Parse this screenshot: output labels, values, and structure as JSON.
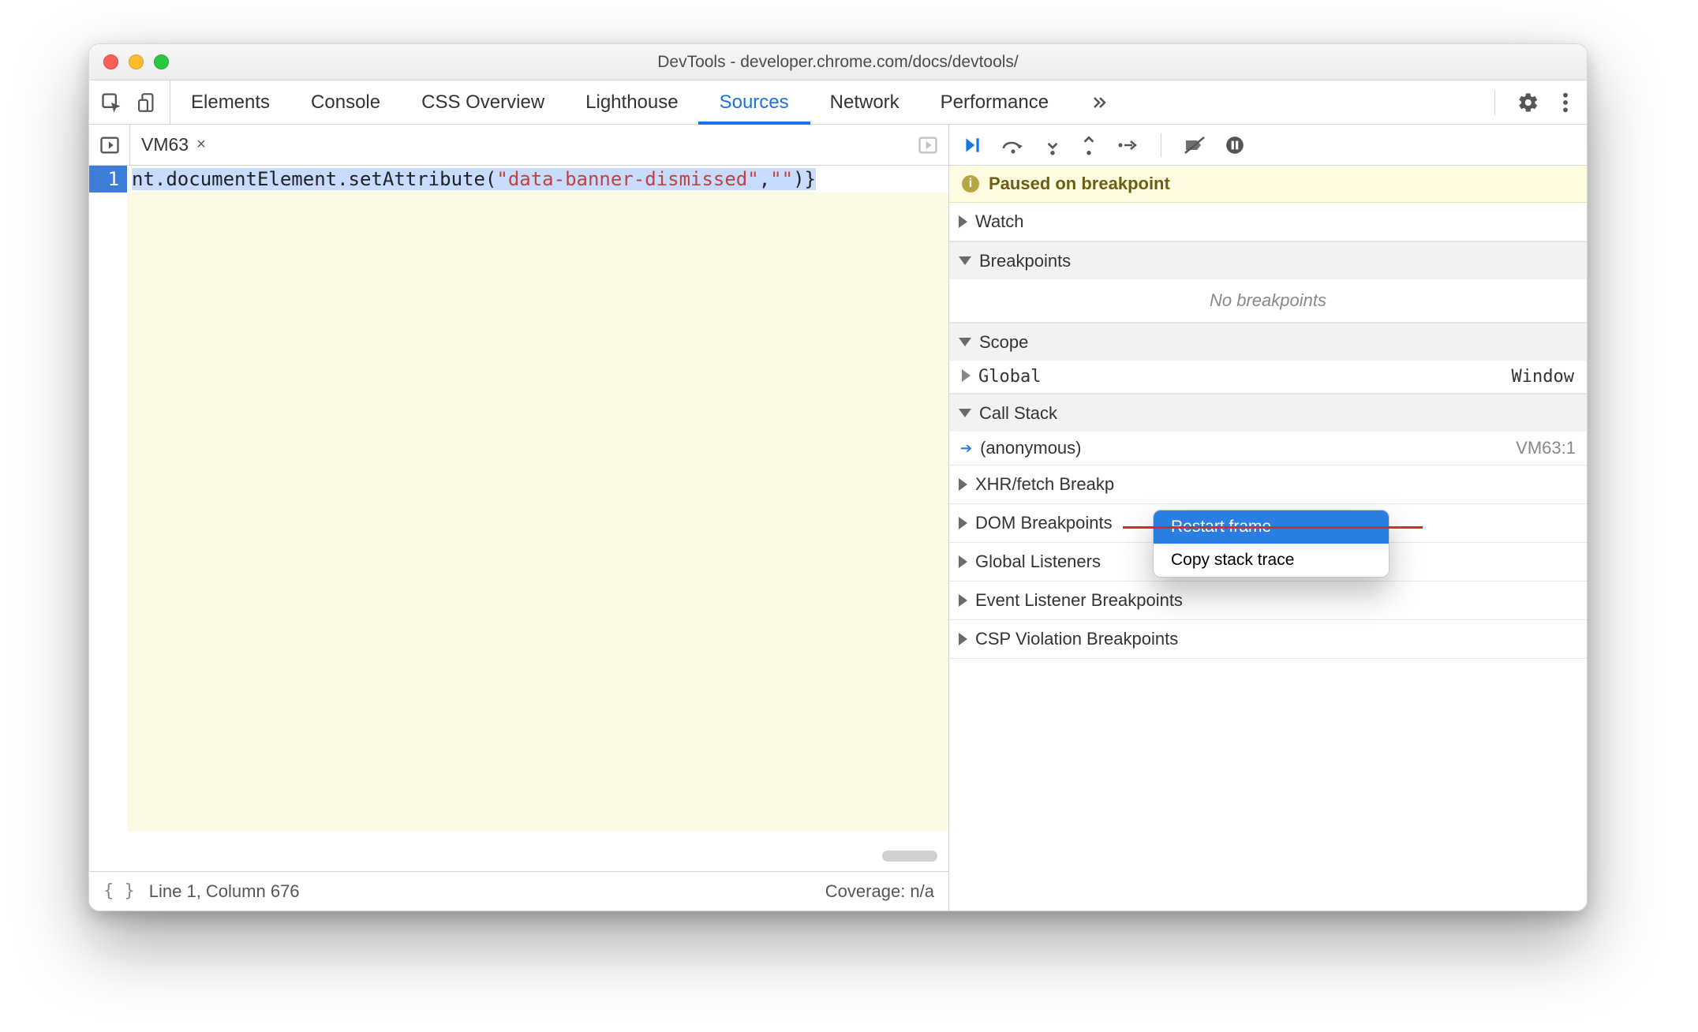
{
  "window": {
    "title": "DevTools - developer.chrome.com/docs/devtools/"
  },
  "tabs": {
    "items": [
      "Elements",
      "Console",
      "CSS Overview",
      "Lighthouse",
      "Sources",
      "Network",
      "Performance"
    ],
    "active": "Sources"
  },
  "file_tab": {
    "name": "VM63"
  },
  "editor": {
    "line_number": "1",
    "code_prefix": "nt.documentElement.setAttribute(",
    "code_string": "\"data-banner-dismissed\"",
    "code_mid": ",",
    "code_string2": "\"\"",
    "code_suffix": ")}"
  },
  "status": {
    "pretty": "{ }",
    "position": "Line 1, Column 676",
    "coverage": "Coverage: n/a"
  },
  "paused_message": "Paused on breakpoint",
  "sections": {
    "watch": "Watch",
    "breakpoints": "Breakpoints",
    "no_breakpoints": "No breakpoints",
    "scope": "Scope",
    "scope_global_label": "Global",
    "scope_global_value": "Window",
    "call_stack": "Call Stack",
    "call_frame_name": "(anonymous)",
    "call_frame_loc": "VM63:1",
    "xhr": "XHR/fetch Breakp",
    "dom": "DOM Breakpoints",
    "global_listeners": "Global Listeners",
    "event_listener": "Event Listener Breakpoints",
    "csp": "CSP Violation Breakpoints"
  },
  "context_menu": {
    "restart": "Restart frame",
    "copy": "Copy stack trace"
  }
}
